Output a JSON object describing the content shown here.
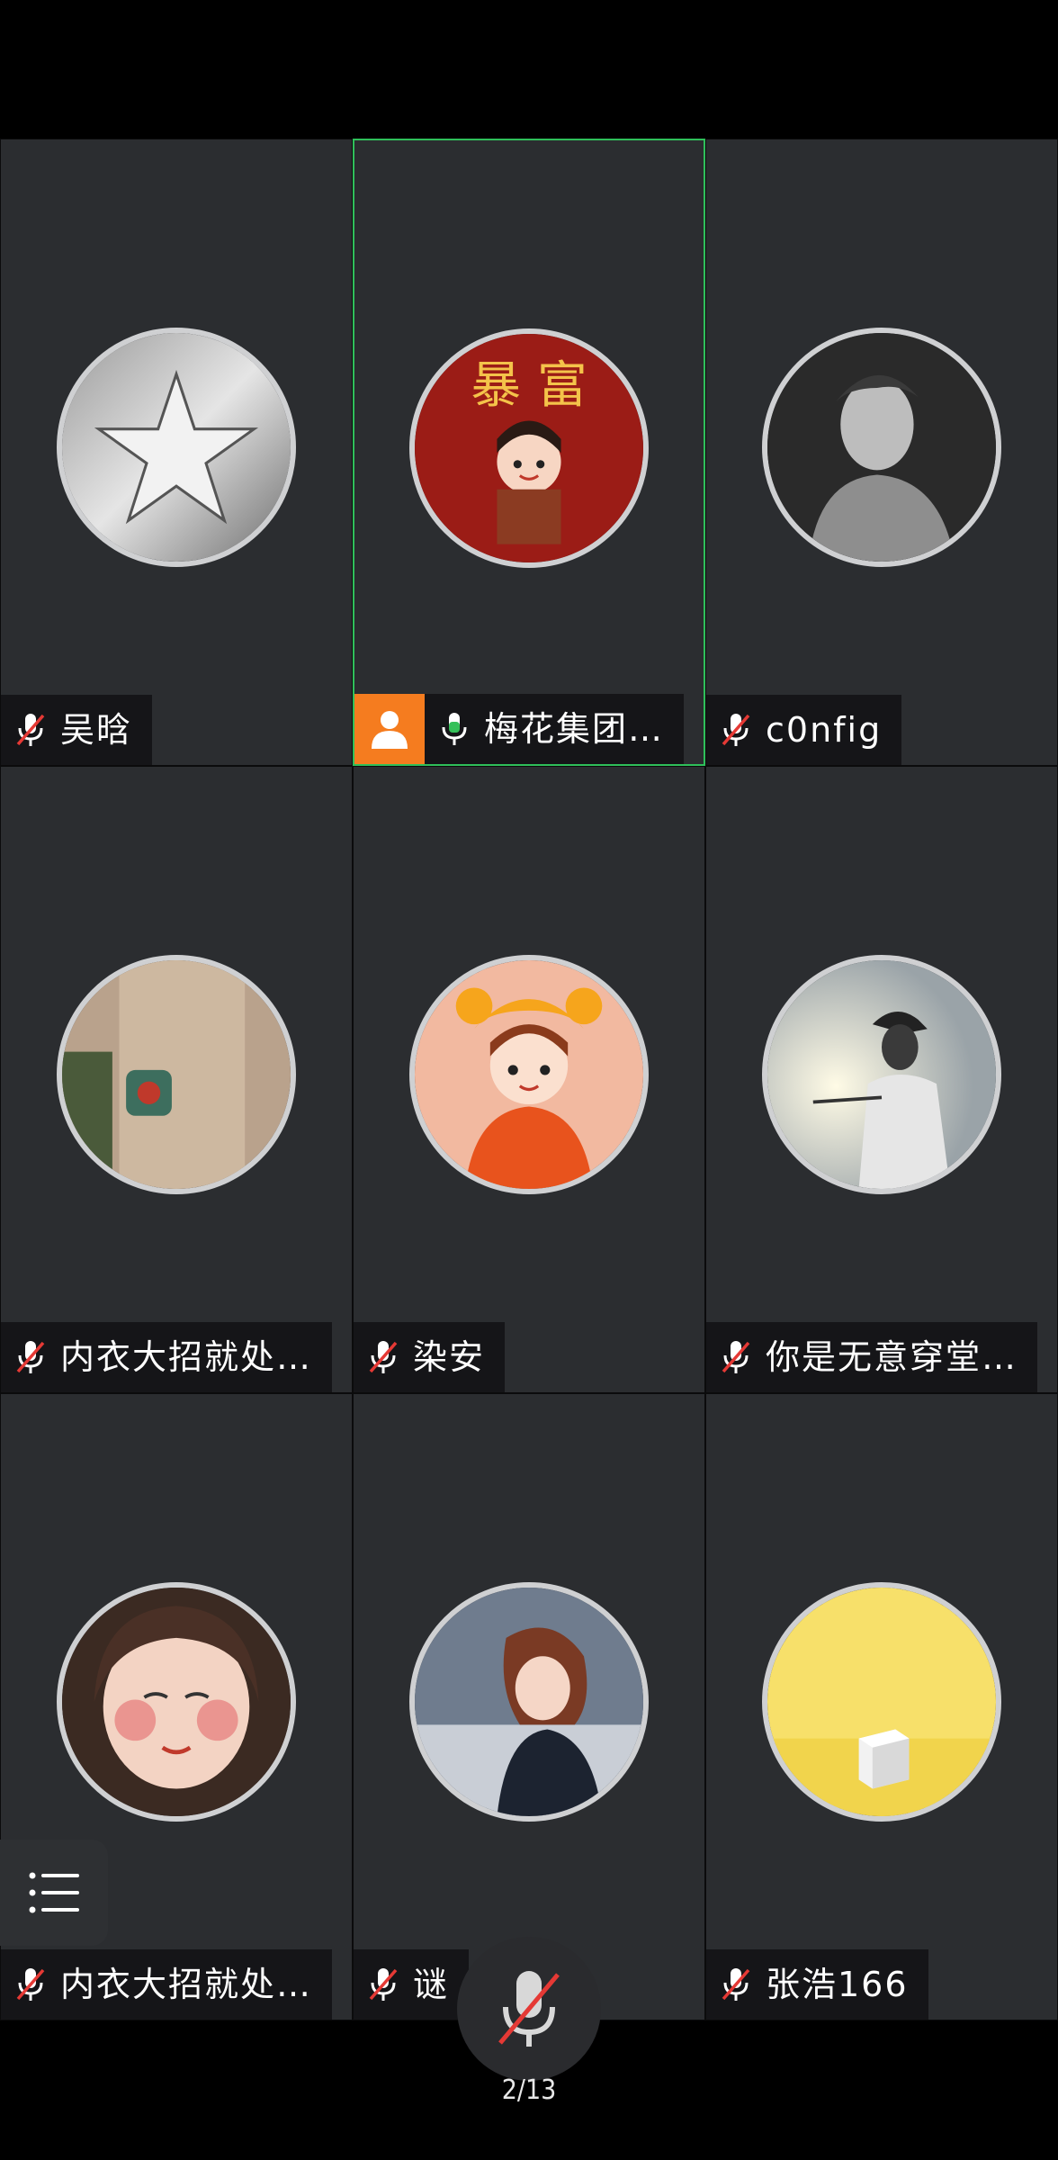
{
  "participants": [
    {
      "name": "吴晗",
      "mic": "muted",
      "avatar": "silver-star-icon",
      "host": false,
      "speaking": false
    },
    {
      "name": "梅花集团…",
      "mic": "on",
      "avatar": "cartoon-girl-avatar",
      "host": true,
      "speaking": true
    },
    {
      "name": "c0nfig",
      "mic": "muted",
      "avatar": "man-portrait-avatar",
      "host": false,
      "speaking": false
    },
    {
      "name": "内衣大招就处…",
      "mic": "muted",
      "avatar": "photo-avatar",
      "host": false,
      "speaking": false
    },
    {
      "name": "染安",
      "mic": "muted",
      "avatar": "tiger-hat-girl-avatar",
      "host": false,
      "speaking": false
    },
    {
      "name": "你是无意穿堂…",
      "mic": "muted",
      "avatar": "silhouette-photo-avatar",
      "host": false,
      "speaking": false
    },
    {
      "name": "内衣大招就处…",
      "mic": "muted",
      "avatar": "girl-face-avatar",
      "host": false,
      "speaking": false
    },
    {
      "name": "谜",
      "mic": "muted",
      "avatar": "anime-girl-avatar",
      "host": false,
      "speaking": false
    },
    {
      "name": "张浩166",
      "mic": "muted",
      "avatar": "yellow-cube-avatar",
      "host": false,
      "speaking": false
    }
  ],
  "page_indicator": "2/13",
  "colors": {
    "speaking_border": "#2fbf5a",
    "host_badge": "#f57c1f",
    "tile_bg": "#2b2d30",
    "muted_slash": "#e53935",
    "mic_on": "#35c05a"
  }
}
